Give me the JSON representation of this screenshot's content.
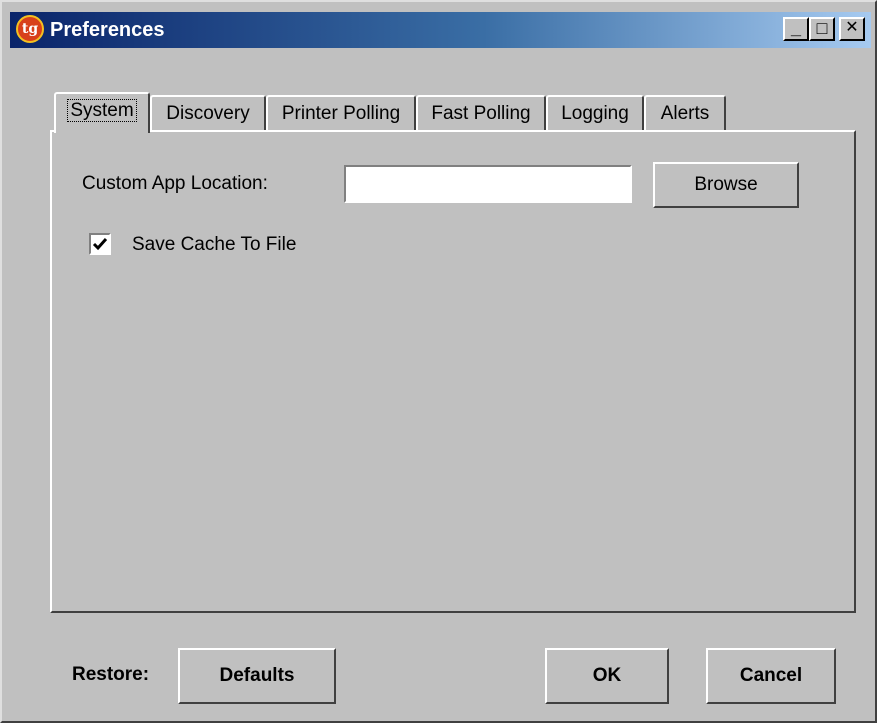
{
  "window": {
    "title": "Preferences",
    "app_icon_text": "tg",
    "minimize_glyph": "_",
    "maximize_glyph": "□",
    "close_glyph": "✕"
  },
  "tabs": [
    {
      "label": "System",
      "active": true
    },
    {
      "label": "Discovery",
      "active": false
    },
    {
      "label": "Printer Polling",
      "active": false
    },
    {
      "label": "Fast Polling",
      "active": false
    },
    {
      "label": "Logging",
      "active": false
    },
    {
      "label": "Alerts",
      "active": false
    }
  ],
  "system": {
    "custom_app_location_label": "Custom App Location:",
    "custom_app_location_value": "",
    "browse_label": "Browse",
    "save_cache_label": "Save Cache To File",
    "save_cache_checked": true
  },
  "footer": {
    "restore_label": "Restore:",
    "defaults_label": "Defaults",
    "ok_label": "OK",
    "cancel_label": "Cancel"
  },
  "icons": [
    "app-icon",
    "minimize-icon",
    "maximize-icon",
    "close-icon",
    "checkmark-icon"
  ]
}
